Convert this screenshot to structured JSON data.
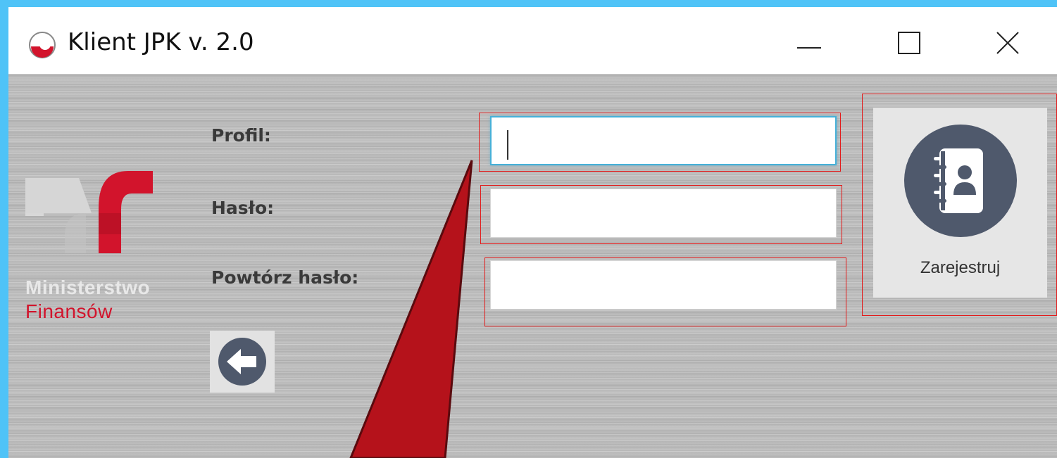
{
  "window": {
    "title": "Klient JPK v. 2.0",
    "icon": "jpk-app-icon",
    "controls": [
      "minimize-icon",
      "maximize-icon",
      "close-icon"
    ]
  },
  "logo": {
    "line1": "Ministerstwo",
    "line2": "Finansów",
    "line1_color": "#e8e8e8",
    "line2_color": "#d2142c",
    "mark_color": "#d2142c"
  },
  "form": {
    "profile_label": "Profil:",
    "profile_value": "",
    "password_label": "Hasło:",
    "password_value": "",
    "repeat_password_label": "Powtórz hasło:",
    "repeat_password_value": ""
  },
  "actions": {
    "register_label": "Zarejestruj",
    "register_icon": "address-book-icon",
    "back_icon": "arrow-left-icon"
  },
  "annotations": {
    "highlight_color": "#e21b1b",
    "callout_color": "#b5121b"
  }
}
